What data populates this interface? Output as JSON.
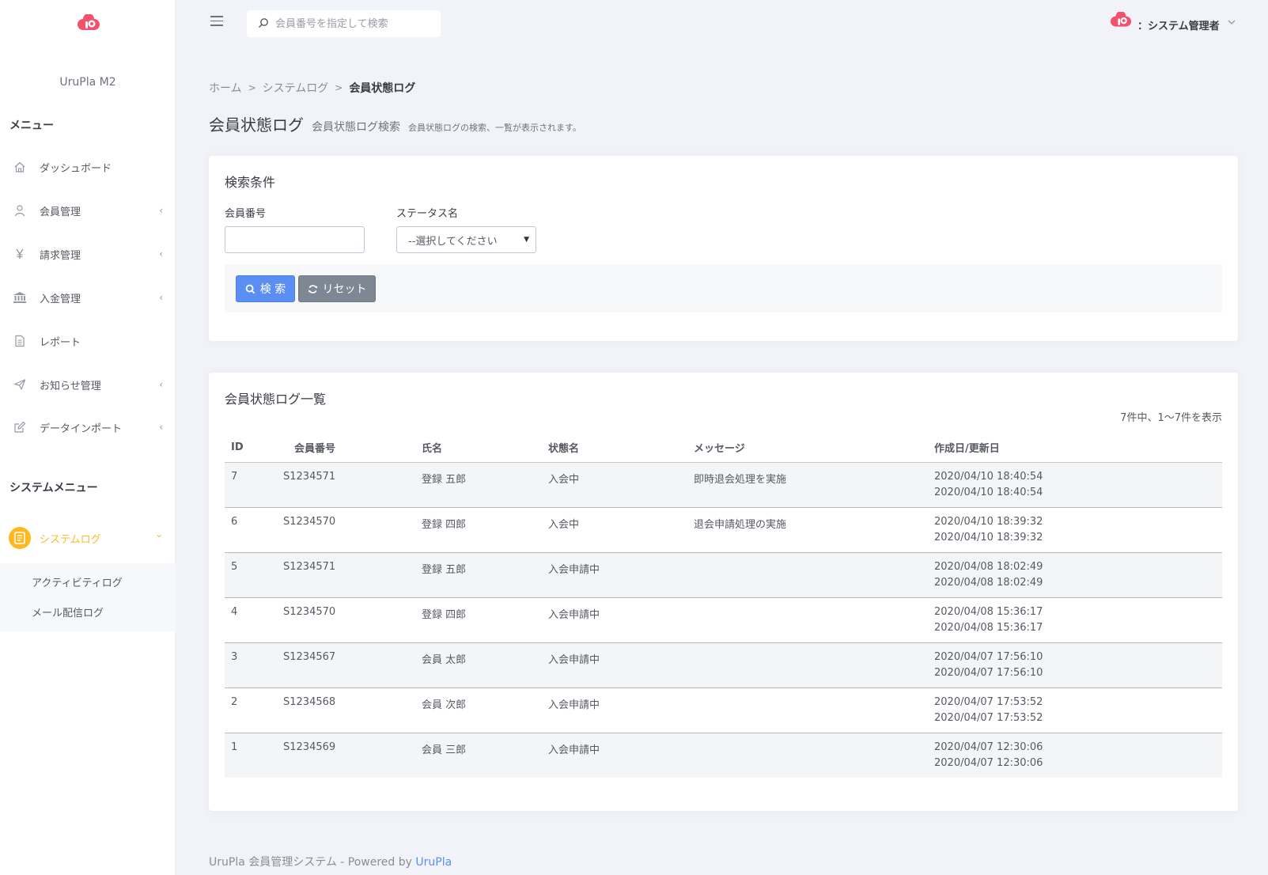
{
  "app": {
    "brand": "UruPla M2",
    "accent_color": "#ffb822",
    "primary_color": "#5b8ef2",
    "logo_color": "#f4516c"
  },
  "sidebar": {
    "menu_title": "メニュー",
    "items": [
      {
        "label": "ダッシュボード",
        "icon": "home-icon",
        "has_children": false
      },
      {
        "label": "会員管理",
        "icon": "user-icon",
        "has_children": true
      },
      {
        "label": "請求管理",
        "icon": "yen-icon",
        "has_children": true
      },
      {
        "label": "入金管理",
        "icon": "bank-icon",
        "has_children": true
      },
      {
        "label": "レポート",
        "icon": "document-icon",
        "has_children": false
      },
      {
        "label": "お知らせ管理",
        "icon": "send-icon",
        "has_children": true
      },
      {
        "label": "データインポート",
        "icon": "edit-icon",
        "has_children": true
      }
    ],
    "system_title": "システムメニュー",
    "system_item": {
      "label": "システムログ",
      "icon": "log-icon",
      "chevron": "⌄"
    },
    "sub_items": [
      "アクティビティログ",
      "メール配信ログ"
    ],
    "chevron": "‹"
  },
  "topbar": {
    "search_placeholder": "会員番号を指定して検索",
    "user_name": "：システム管理者"
  },
  "breadcrumb": {
    "items": [
      "ホーム",
      "システムログ",
      "会員状態ログ"
    ],
    "separator": ">"
  },
  "page": {
    "title": "会員状態ログ",
    "subtitle": "会員状態ログ検索",
    "description": "会員状態ログの検索、一覧が表示されます。"
  },
  "search_card": {
    "title": "検索条件",
    "member_no_label": "会員番号",
    "member_no_value": "",
    "status_label": "ステータス名",
    "status_selected": "--選択してください",
    "search_button": "検 索",
    "reset_button": "リセット"
  },
  "list_card": {
    "title": "会員状態ログ一覧",
    "count_text": "7件中、1〜7件を表示",
    "columns": [
      "ID",
      "会員番号",
      "氏名",
      "状態名",
      "メッセージ",
      "作成日/更新日"
    ],
    "rows": [
      {
        "id": "7",
        "member_no": "S1234571",
        "name": "登録 五郎",
        "status": "入会中",
        "message": "即時退会処理を実施",
        "created": "2020/04/10 18:40:54",
        "updated": "2020/04/10 18:40:54"
      },
      {
        "id": "6",
        "member_no": "S1234570",
        "name": "登録 四郎",
        "status": "入会中",
        "message": "退会申請処理の実施",
        "created": "2020/04/10 18:39:32",
        "updated": "2020/04/10 18:39:32"
      },
      {
        "id": "5",
        "member_no": "S1234571",
        "name": "登録 五郎",
        "status": "入会申請中",
        "message": "",
        "created": "2020/04/08 18:02:49",
        "updated": "2020/04/08 18:02:49"
      },
      {
        "id": "4",
        "member_no": "S1234570",
        "name": "登録 四郎",
        "status": "入会申請中",
        "message": "",
        "created": "2020/04/08 15:36:17",
        "updated": "2020/04/08 15:36:17"
      },
      {
        "id": "3",
        "member_no": "S1234567",
        "name": "会員 太郎",
        "status": "入会申請中",
        "message": "",
        "created": "2020/04/07 17:56:10",
        "updated": "2020/04/07 17:56:10"
      },
      {
        "id": "2",
        "member_no": "S1234568",
        "name": "会員 次郎",
        "status": "入会申請中",
        "message": "",
        "created": "2020/04/07 17:53:52",
        "updated": "2020/04/07 17:53:52"
      },
      {
        "id": "1",
        "member_no": "S1234569",
        "name": "会員 三郎",
        "status": "入会申請中",
        "message": "",
        "created": "2020/04/07 12:30:06",
        "updated": "2020/04/07 12:30:06"
      }
    ]
  },
  "footer": {
    "text": "UruPla 会員管理システム - Powered by ",
    "link": "UruPla"
  }
}
